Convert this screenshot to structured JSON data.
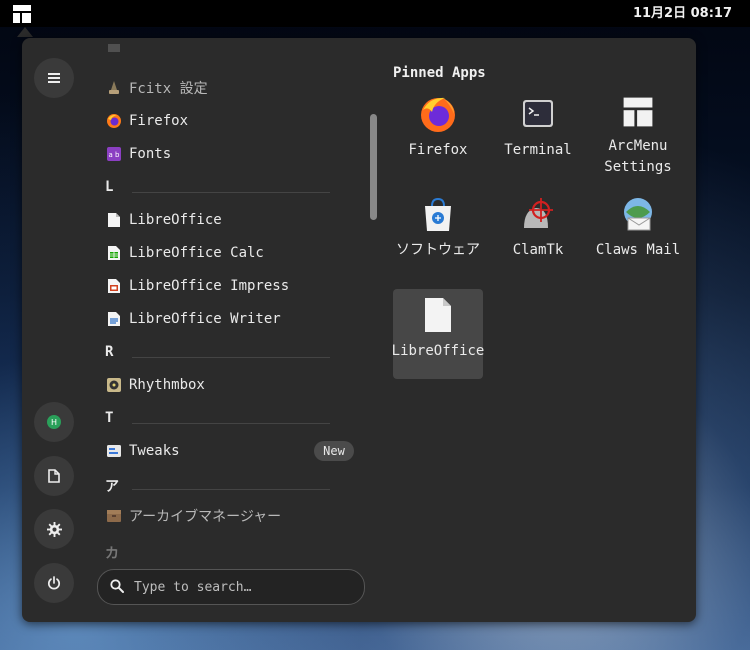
{
  "topbar": {
    "clock": "11月2日 08:17"
  },
  "menu": {
    "apps": [
      {
        "label": "Fcitx 設定",
        "icon": "fcitx-icon",
        "dim": true
      },
      {
        "label": "Firefox",
        "icon": "firefox-icon"
      },
      {
        "label": "Fonts",
        "icon": "fonts-icon"
      },
      {
        "letter": "L"
      },
      {
        "label": "LibreOffice",
        "icon": "libreoffice-icon"
      },
      {
        "label": "LibreOffice Calc",
        "icon": "libreoffice-calc-icon"
      },
      {
        "label": "LibreOffice Impress",
        "icon": "libreoffice-impress-icon"
      },
      {
        "label": "LibreOffice Writer",
        "icon": "libreoffice-writer-icon"
      },
      {
        "letter": "R"
      },
      {
        "label": "Rhythmbox",
        "icon": "rhythmbox-icon"
      },
      {
        "letter": "T"
      },
      {
        "label": "Tweaks",
        "icon": "tweaks-icon",
        "badge": "New"
      },
      {
        "letter": "ア"
      },
      {
        "label": "アーカイブマネージャー",
        "icon": "archive-manager-icon",
        "dim": true
      },
      {
        "letter": "カ"
      }
    ],
    "search": {
      "placeholder": "Type to search…"
    },
    "pinned_title": "Pinned Apps",
    "pinned": [
      {
        "label": "Firefox",
        "icon": "firefox-icon"
      },
      {
        "label": "Terminal",
        "icon": "terminal-icon"
      },
      {
        "label": "ArcMenu Settings",
        "icon": "arcmenu-settings-icon"
      },
      {
        "label": "ソフトウェア",
        "icon": "software-icon"
      },
      {
        "label": "ClamTk",
        "icon": "clamtk-icon"
      },
      {
        "label": "Claws Mail",
        "icon": "claws-mail-icon"
      },
      {
        "label": "LibreOffice",
        "icon": "libreoffice-icon",
        "selected": true
      }
    ],
    "user_initial": "H"
  }
}
